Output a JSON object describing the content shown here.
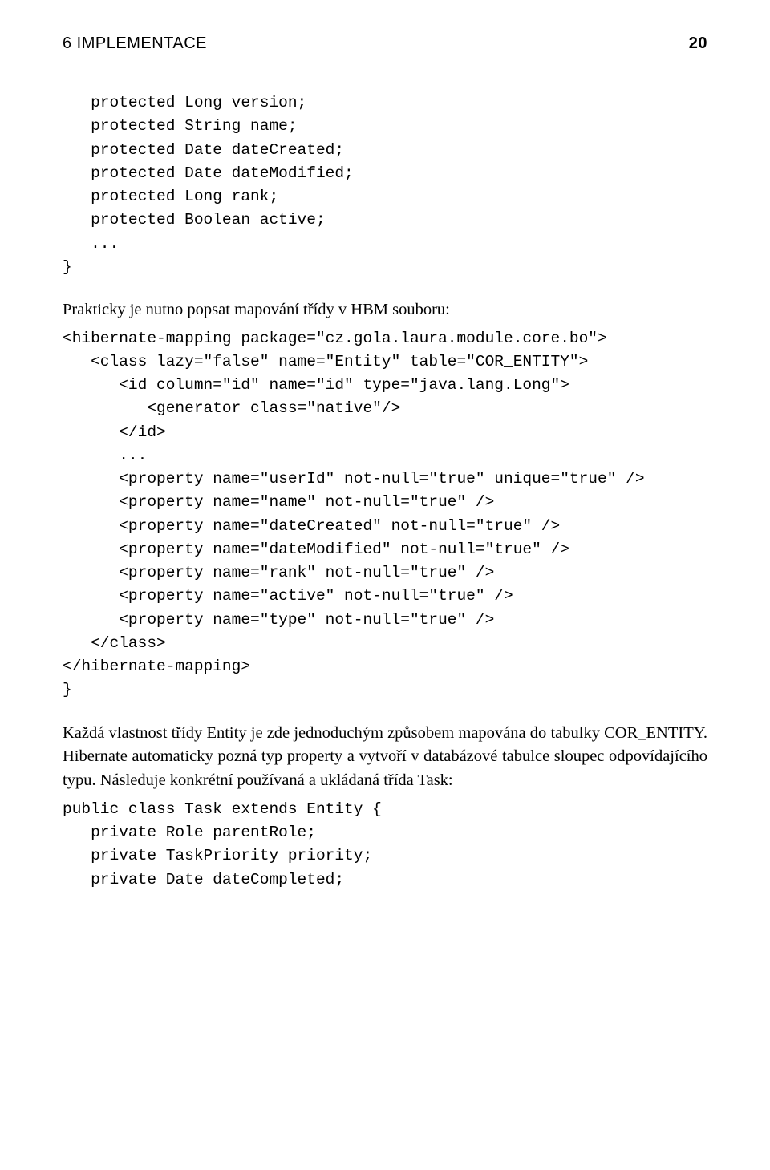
{
  "header": {
    "section": "6 IMPLEMENTACE",
    "page": "20"
  },
  "code1": [
    "   protected Long version;",
    "   protected String name;",
    "   protected Date dateCreated;",
    "   protected Date dateModified;",
    "   protected Long rank;",
    "   protected Boolean active;",
    "   ...",
    "}"
  ],
  "para1": "Prakticky je nutno popsat mapování třídy v HBM souboru:",
  "code2": [
    "<hibernate-mapping package=\"cz.gola.laura.module.core.bo\">",
    "   <class lazy=\"false\" name=\"Entity\" table=\"COR_ENTITY\">",
    "      <id column=\"id\" name=\"id\" type=\"java.lang.Long\">",
    "         <generator class=\"native\"/>",
    "      </id>",
    "      ...",
    "      <property name=\"userId\" not-null=\"true\" unique=\"true\" />",
    "      <property name=\"name\" not-null=\"true\" />",
    "      <property name=\"dateCreated\" not-null=\"true\" />",
    "      <property name=\"dateModified\" not-null=\"true\" />",
    "      <property name=\"rank\" not-null=\"true\" />",
    "      <property name=\"active\" not-null=\"true\" />",
    "      <property name=\"type\" not-null=\"true\" />",
    "   </class>",
    "</hibernate-mapping>",
    "}"
  ],
  "para2": "Každá vlastnost třídy Entity je zde jednoduchým způsobem mapována do tabulky COR_ENTITY. Hibernate automaticky pozná typ property a vytvoří v databázové tabulce sloupec odpovídajícího typu. Následuje konkrétní používaná a ukládaná třída Task:",
  "code3": [
    "public class Task extends Entity {",
    "   private Role parentRole;",
    "   private TaskPriority priority;",
    "   private Date dateCompleted;"
  ]
}
